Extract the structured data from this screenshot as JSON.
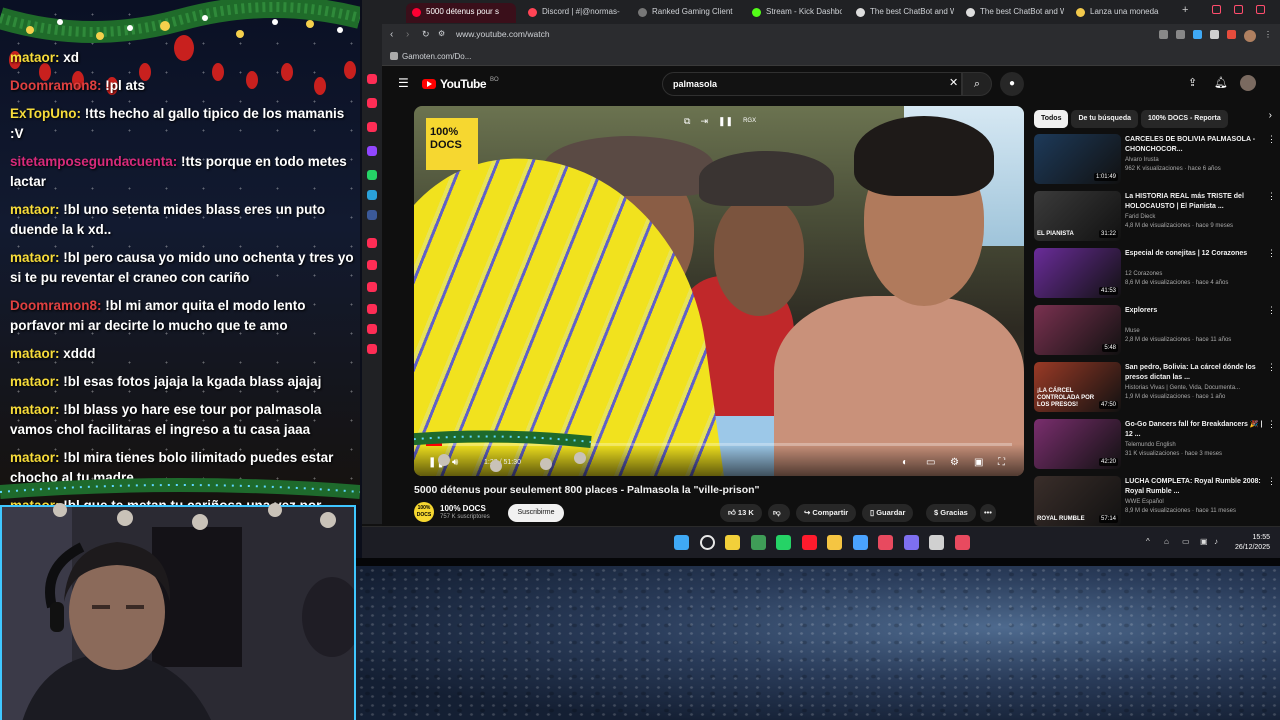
{
  "chat": {
    "messages": [
      {
        "user": "mataor:",
        "text": "xd",
        "user_color": "#f7dc3a"
      },
      {
        "user": "Doomramon8:",
        "text": "!pl ats",
        "user_color": "#e04040"
      },
      {
        "user": "ExTopUno:",
        "text": "!tts hecho al gallo tipico de los mamanis :V",
        "user_color": "#f7dc3a"
      },
      {
        "user": "sitetamposegundacuenta:",
        "text": "!tts porque en todo metes lactar",
        "user_color": "#d82a7a"
      },
      {
        "user": "mataor:",
        "text": "!bl uno setenta mides blass eres un puto duende la k xd..",
        "user_color": "#f7dc3a"
      },
      {
        "user": "mataor:",
        "text": "!bl pero causa yo mido uno ochenta y tres yo si te pu reventar el craneo con cariño",
        "user_color": "#f7dc3a"
      },
      {
        "user": "Doomramon8:",
        "text": "!bl mi amor quita el modo lento porfavor mi ar decirte lo mucho que te amo",
        "user_color": "#e04040"
      },
      {
        "user": "mataor:",
        "text": "xddd",
        "user_color": "#f7dc3a"
      },
      {
        "user": "mataor:",
        "text": "!bl esas fotos jajaja la kgada blass ajajaj",
        "user_color": "#f7dc3a"
      },
      {
        "user": "mataor:",
        "text": "!bl blass yo hare ese tour por palmasola vamos chol facilitaras el ingreso a tu casa jaaa",
        "user_color": "#f7dc3a"
      },
      {
        "user": "mataor:",
        "text": "!bl mira tienes bolo ilimitado puedes estar chocho al tu madre",
        "user_color": "#f7dc3a"
      },
      {
        "user": "mataor:",
        "text": "!bl que te metan tu cariñosa una vez por semana y b",
        "user_color": "#f7dc3a"
      }
    ]
  },
  "browser": {
    "tabs": [
      {
        "label": "5000 détenus pour s",
        "color": "#ff0033",
        "active": true
      },
      {
        "label": "Discord | #|@normas-",
        "color": "#ff4455",
        "active": false
      },
      {
        "label": "Ranked Gaming Client",
        "color": "#777777",
        "active": false
      },
      {
        "label": "Stream - Kick Dashboard",
        "color": "#53fc18",
        "active": false
      },
      {
        "label": "The best ChatBot and W",
        "color": "#dddddd",
        "active": false
      },
      {
        "label": "The best ChatBot and W",
        "color": "#dddddd",
        "active": false
      },
      {
        "label": "Lanza una moneda",
        "color": "#f2c94c",
        "active": false
      }
    ],
    "new_tab": "+",
    "url": "www.youtube.com/watch",
    "bookmark": "Gamoten.com/Do..."
  },
  "youtube": {
    "logo_text": "YouTube",
    "logo_sup": "BO",
    "search_query": "palmasola",
    "video": {
      "title": "5000 détenus pour seulement 800 places - Palmasola la \"ville-prison\"",
      "channel": "100% DOCS",
      "subscribers": "757 K suscriptores",
      "subscribe_label": "Suscribirme",
      "likes": "13 K",
      "share_label": "Compartir",
      "save_label": "Guardar",
      "thanks_label": "Gracias",
      "more_label": "•••",
      "logo_line1": "100%",
      "logo_line2": "DOCS",
      "time": "1:22 / 51:30",
      "progress": 0.028
    },
    "chips": [
      {
        "label": "Todos",
        "active": true
      },
      {
        "label": "De tu búsqueda",
        "active": false
      },
      {
        "label": "100% DOCS - Reporta",
        "active": false
      }
    ],
    "recommendations": [
      {
        "title": "CARCELES DE BOLIVIA PALMASOLA - CHONCHOCOR...",
        "channel": "Alvaro Irusta",
        "meta": "962 K visualizaciones · hace 6 años",
        "duration": "1:01:49",
        "thumb": "#1d3a5a"
      },
      {
        "title": "La HISTORIA REAL más TRISTE del HOLOCAUSTO | El Pianista ...",
        "channel": "Farid Dieck",
        "meta": "4,8 M de visualizaciones · hace 9 meses",
        "duration": "31:22",
        "thumb": "#3b3b3b",
        "overlay": "EL PIANISTA"
      },
      {
        "title": "Especial de conejitas | 12 Corazones",
        "channel": "12 Corazones",
        "meta": "8,6 M de visualizaciones · hace 4 años",
        "duration": "41:53",
        "thumb": "#6a2c9a"
      },
      {
        "title": "Explorers",
        "channel": "Muse",
        "meta": "2,8 M de visualizaciones · hace 11 años",
        "duration": "5:48",
        "thumb": "#7a3150"
      },
      {
        "title": "San pedro, Bolivia: La cárcel dónde los presos dictan las ...",
        "channel": "Historias Vivas | Gente, Vida, Documenta...",
        "meta": "1,9 M de visualizaciones · hace 1 año",
        "duration": "47:50",
        "thumb": "#9a3a26",
        "overlay": "¡LA CÁRCEL CONTROLADA POR LOS PRESOS!"
      },
      {
        "title": "Go-Go Dancers fall for Breakdancers 🎉 | 12 ...",
        "channel": "Telemundo English",
        "meta": "31 K visualizaciones · hace 3 meses",
        "duration": "42:20",
        "thumb": "#7a2e6e"
      },
      {
        "title": "LUCHA COMPLETA: Royal Rumble 2008: Royal Rumble ...",
        "channel": "WWE Español",
        "meta": "8,9 M de visualizaciones · hace 11 meses",
        "duration": "57:14",
        "thumb": "#3a2e2a",
        "overlay": "ROYAL RUMBLE"
      }
    ]
  },
  "taskbar": {
    "time": "15:55",
    "date": "26/12/2025",
    "icons": [
      {
        "name": "windows-start-icon",
        "color": "#3fa9f5"
      },
      {
        "name": "search-icon",
        "color": "#e8e8e8"
      },
      {
        "name": "notes-icon",
        "color": "#f2d03a"
      },
      {
        "name": "chrome-icon",
        "color": "#3f9d57"
      },
      {
        "name": "whatsapp-icon",
        "color": "#25d366"
      },
      {
        "name": "opera-icon",
        "color": "#ff1b2d"
      },
      {
        "name": "file-explorer-icon",
        "color": "#f5c542"
      },
      {
        "name": "store-icon",
        "color": "#4aa3ff"
      },
      {
        "name": "app-icon",
        "color": "#e84a5f"
      },
      {
        "name": "discord-icon",
        "color": "#7e6ff0"
      },
      {
        "name": "obs-icon",
        "color": "#d0d0d0"
      },
      {
        "name": "app2-icon",
        "color": "#e84a5f"
      }
    ]
  }
}
